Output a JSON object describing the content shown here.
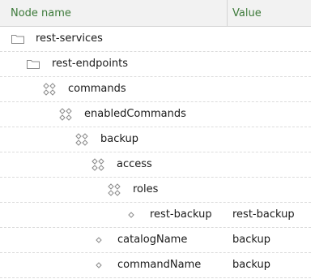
{
  "columns": {
    "name": "Node name",
    "value": "Value"
  },
  "rows": [
    {
      "label": "rest-services",
      "value": "",
      "icon": "folder-icon"
    },
    {
      "label": "rest-endpoints",
      "value": "",
      "icon": "folder-icon"
    },
    {
      "label": "commands",
      "value": "",
      "icon": "node-group-icon"
    },
    {
      "label": "enabledCommands",
      "value": "",
      "icon": "node-group-icon"
    },
    {
      "label": "backup",
      "value": "",
      "icon": "node-group-icon"
    },
    {
      "label": "access",
      "value": "",
      "icon": "node-group-icon"
    },
    {
      "label": "roles",
      "value": "",
      "icon": "node-group-icon"
    },
    {
      "label": "rest-backup",
      "value": "rest-backup",
      "icon": "property-diamond-icon"
    },
    {
      "label": "catalogName",
      "value": "backup",
      "icon": "property-diamond-icon"
    },
    {
      "label": "commandName",
      "value": "backup",
      "icon": "property-diamond-icon"
    }
  ],
  "colors": {
    "header_text": "#3d7a3a",
    "header_bg": "#f2f2f2",
    "icon_stroke": "#8a8a8a"
  }
}
